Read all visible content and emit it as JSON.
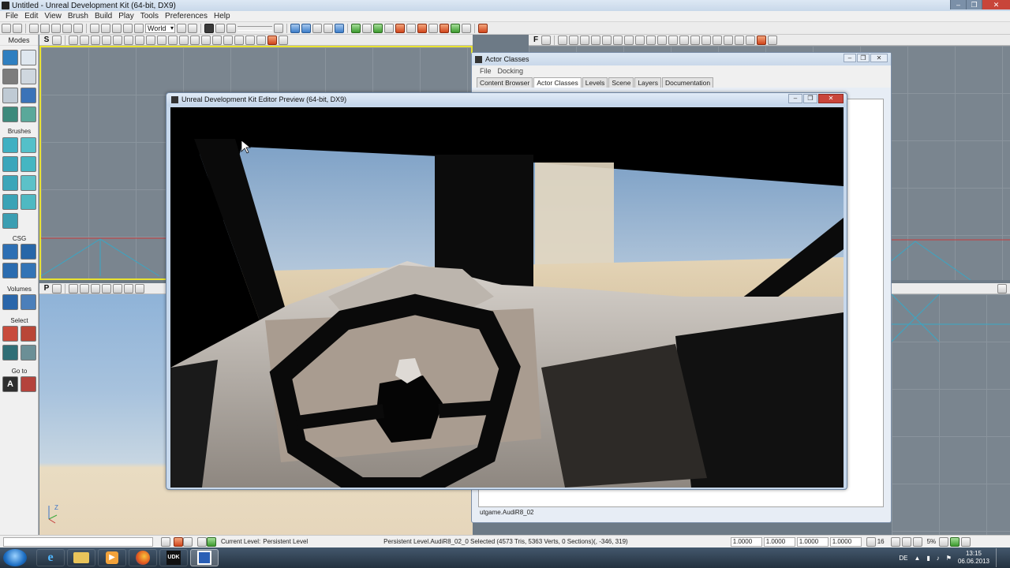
{
  "app": {
    "title": "Untitled - Unreal Development Kit (64-bit, DX9)",
    "menu": [
      "File",
      "Edit",
      "View",
      "Brush",
      "Build",
      "Play",
      "Tools",
      "Preferences",
      "Help"
    ],
    "world_combo": "World"
  },
  "modes_panel": {
    "header": "Modes",
    "groups": [
      "Brushes",
      "CSG",
      "Volumes",
      "Select",
      "Go to"
    ]
  },
  "viewports": {
    "top_right_letters": [
      "F"
    ],
    "bottom_left_letters": [
      "P"
    ],
    "top_left_letters": [
      "S"
    ]
  },
  "actor_classes": {
    "title": "Actor Classes",
    "menu": [
      "File",
      "Docking"
    ],
    "tabs": [
      "Content Browser",
      "Actor Classes",
      "Levels",
      "Scene",
      "Layers",
      "Documentation"
    ],
    "active_tab": "Actor Classes",
    "status": "utgame.AudiR8_02"
  },
  "preview": {
    "title": "Unreal Development Kit Editor Preview (64-bit, DX9)"
  },
  "statusbar": {
    "current_level_label": "Current Level:",
    "current_level": "Persistent Level",
    "selection_info": "Persistent Level.AudiR8_02_0 Selected (4573 Tris, 5363 Verts, 0 Sections)(, -346, 319)",
    "scale_values": [
      "1.0000",
      "1.0000",
      "1.0000",
      "1.0000"
    ],
    "grid_value": "16",
    "percent": "5%"
  },
  "taskbar": {
    "language": "DE",
    "time": "13:15",
    "date": "06.06.2013"
  }
}
